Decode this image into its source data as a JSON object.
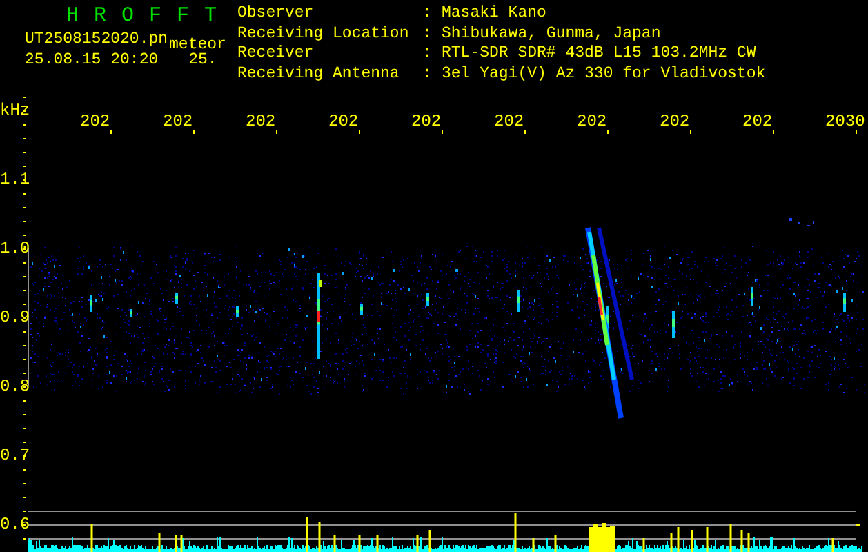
{
  "header": {
    "title": "H R O F F T",
    "file_name": "UT2508152020.pn",
    "mode": "meteor",
    "timestamp": "25.08.15 20:20",
    "count": "25."
  },
  "station": [
    {
      "label": "Observer",
      "separator": ":",
      "value": "Masaki Kano"
    },
    {
      "label": "Receiving Location",
      "separator": ":",
      "value": "Shibukawa, Gunma, Japan"
    },
    {
      "label": "Receiver",
      "separator": ":",
      "value": "RTL-SDR SDR# 43dB L15 103.2MHz CW"
    },
    {
      "label": "Receiving Antenna",
      "separator": ":",
      "value": "3el Yagi(V) Az 330 for Vladivostok"
    }
  ],
  "plot": {
    "y_unit": "kHz",
    "y_labels": [
      "1.1",
      "1.0",
      "0.9",
      "0.8",
      "0.7",
      "0.6"
    ],
    "x_labels": [
      "202",
      "202",
      "202",
      "202",
      "202",
      "202",
      "202",
      "202",
      "202",
      "2030"
    ]
  }
}
